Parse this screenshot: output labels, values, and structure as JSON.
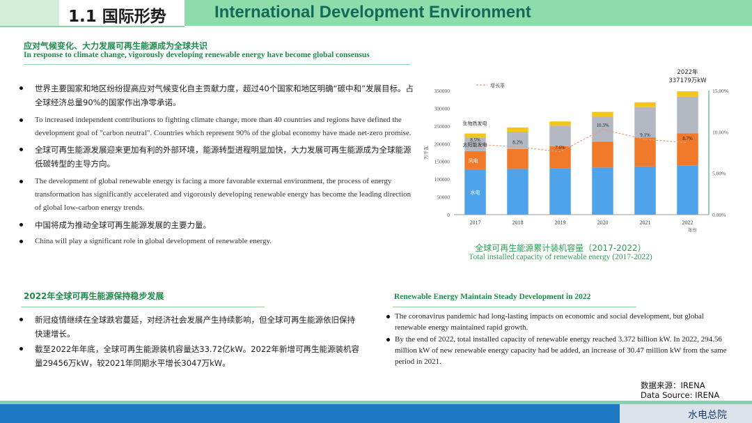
{
  "header": {
    "section_cn": "1.1 国际形势",
    "section_en": "International Development Environment"
  },
  "section1": {
    "title_cn": "应对气候变化、大力发展可再生能源成为全球共识",
    "title_en": "In response to climate change, vigorously developing renewable energy have become global consensus",
    "bullets": [
      "世界主要国家和地区纷纷提高应对气候变化自主贡献力度，超过40个国家和地区明确“碳中和”发展目标。占全球经济总量90%的国家作出净零承诺。",
      "To increased independent contributions to fighting climate change, more than 40 countries and regions have defined the development goal of \"carbon neutral\". Countries which represent 90% of the global economy have made net-zero promise.",
      "全球可再生能源发展迎来更加有利的外部环境，能源转型进程明显加快，大力发展可再生能源成为全球能源低碳转型的主导方向。",
      "The development of global renewable energy is facing a more favorable external environment, the process of energy transformation has significantly accelerated  and vigorously developing renewable energy has become the leading direction of global low-carbon energy trends.",
      "中国将成为推动全球可再生能源发展的主要力量。",
      "China will play a significant role in global development of renewable energy."
    ]
  },
  "section2": {
    "title_cn": "2022年全球可再生能源保持稳步发展",
    "bullets": [
      "新冠疫情继续在全球跌宕蔓延，对经济社会发展产生持续影响，但全球可再生能源依旧保持快速增长。",
      "截至2022年年底，全球可再生能源装机容量达33.72亿kW。2022年新增可再生能源装机容量29456万kW，较2021年同期水平增长3047万kW。"
    ]
  },
  "section3": {
    "title_en": "Renewable Energy Maintain Steady Development in 2022",
    "bullets": [
      "The coronavirus pandemic had long-lasting impacts on economic and social development, but global renewable energy maintained rapid growth.",
      "By the end of 2022, total installed capacity of renewable energy reached 3.372 billion kW. In 2022, 294.56 million kW of new renewable energy capacity had be added, an increase of 30.47 million kW from the same period in 2021."
    ]
  },
  "chart_caption": {
    "cn": "全球可再生能源累计装机容量（2017-2022）",
    "en": "Total installed capacity of renewable energy (2017-2022)"
  },
  "source": {
    "line_cn": "数据来源：IRENA",
    "line_en": "Data Source: IRENA"
  },
  "footer": {
    "org": "水电总院"
  },
  "colors": {
    "hydro": "#4ea3ea",
    "wind": "#f07a2a",
    "solar": "#b4b8c2",
    "bio": "#f5c518",
    "growth": "#e6a07a",
    "accent": "#1f8a4a"
  },
  "chart_data": {
    "type": "bar",
    "stacked": true,
    "categories": [
      "2017",
      "2018",
      "2019",
      "2020",
      "2021",
      "2022"
    ],
    "series": [
      {
        "name": "水电",
        "values": [
          128000,
          129000,
          131000,
          133000,
          136000,
          139000
        ]
      },
      {
        "name": "风电",
        "values": [
          51000,
          56000,
          62000,
          73000,
          82000,
          90000
        ]
      },
      {
        "name": "太阳能发电",
        "values": [
          39000,
          49000,
          58000,
          71000,
          85000,
          104000
        ]
      },
      {
        "name": "生物质发电",
        "values": [
          11000,
          12000,
          12000,
          13000,
          14000,
          15000
        ]
      }
    ],
    "line_series": {
      "name": "增长率",
      "values": [
        8.5,
        8.2,
        7.6,
        10.3,
        9.1,
        8.7
      ],
      "labels": [
        "8.5%",
        "8.2%",
        "7.6%",
        "10.3%",
        "9.1%",
        "8.7%"
      ]
    },
    "y_ticks": [
      "0",
      "50000",
      "100000",
      "150000",
      "200000",
      "250000",
      "300000",
      "350000"
    ],
    "y2_ticks": [
      "0.00%",
      "5.00%",
      "10.00%",
      "15.00%"
    ],
    "ylim": [
      0,
      350000
    ],
    "y2lim": [
      0,
      15
    ],
    "xlabel": "年份",
    "ylabel": "万千瓦",
    "annotation": {
      "year": "2022年",
      "value": "337179万kW"
    }
  }
}
